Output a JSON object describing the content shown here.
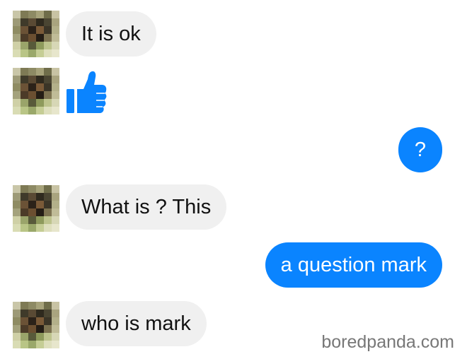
{
  "messages": [
    {
      "sender": "contact",
      "kind": "text",
      "text": "It is ok"
    },
    {
      "sender": "contact",
      "kind": "like-sticker",
      "icon": "thumbs-up-icon"
    },
    {
      "sender": "me",
      "kind": "text",
      "text": "?"
    },
    {
      "sender": "contact",
      "kind": "text",
      "text": "What is ? This"
    },
    {
      "sender": "me",
      "kind": "text",
      "text": "a question mark"
    },
    {
      "sender": "contact",
      "kind": "text",
      "text": "who is mark"
    }
  ],
  "watermark": "boredpanda.com",
  "colors": {
    "outgoing_bubble": "#0a84ff",
    "incoming_bubble": "#f0f0f0",
    "like_icon": "#0a84ff"
  }
}
